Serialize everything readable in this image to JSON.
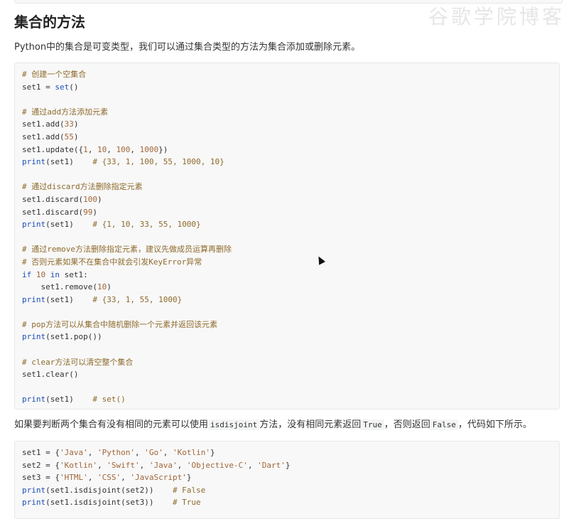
{
  "page": {
    "watermark": "谷歌学院博客",
    "heading": "集合的方法",
    "intro": "Python中的集合是可变类型，我们可以通过集合类型的方法为集合添加或删除元素。",
    "disjoint_text": {
      "before": "如果要判断两个集合有没有相同的元素可以使用",
      "method": "isdisjoint",
      "middle": "方法，没有相同元素返回",
      "true_val": "True",
      "mid2": "，否则返回",
      "false_val": "False",
      "after": "，代码如下所示。"
    }
  },
  "code_block_1": {
    "lines": [
      [
        {
          "t": "# 创建一个空集合",
          "c": "c"
        }
      ],
      [
        {
          "t": "set1 = "
        },
        {
          "t": "set",
          "c": "k"
        },
        {
          "t": "()"
        }
      ],
      [],
      [
        {
          "t": "# 通过add方法添加元素",
          "c": "c"
        }
      ],
      [
        {
          "t": "set1.add("
        },
        {
          "t": "33",
          "c": "n"
        },
        {
          "t": ")"
        }
      ],
      [
        {
          "t": "set1.add("
        },
        {
          "t": "55",
          "c": "n"
        },
        {
          "t": ")"
        }
      ],
      [
        {
          "t": "set1.update({"
        },
        {
          "t": "1",
          "c": "n"
        },
        {
          "t": ", "
        },
        {
          "t": "10",
          "c": "n"
        },
        {
          "t": ", "
        },
        {
          "t": "100",
          "c": "n"
        },
        {
          "t": ", "
        },
        {
          "t": "1000",
          "c": "n"
        },
        {
          "t": "})"
        }
      ],
      [
        {
          "t": "print",
          "c": "k"
        },
        {
          "t": "(set1)    "
        },
        {
          "t": "# {33, 1, 100, 55, 1000, 10}",
          "c": "c"
        }
      ],
      [],
      [
        {
          "t": "# 通过discard方法删除指定元素",
          "c": "c"
        }
      ],
      [
        {
          "t": "set1.discard("
        },
        {
          "t": "100",
          "c": "n"
        },
        {
          "t": ")"
        }
      ],
      [
        {
          "t": "set1.discard("
        },
        {
          "t": "99",
          "c": "n"
        },
        {
          "t": ")"
        }
      ],
      [
        {
          "t": "print",
          "c": "k"
        },
        {
          "t": "(set1)    "
        },
        {
          "t": "# {1, 10, 33, 55, 1000}",
          "c": "c"
        }
      ],
      [],
      [
        {
          "t": "# 通过remove方法删除指定元素，建议先做成员运算再删除",
          "c": "c"
        }
      ],
      [
        {
          "t": "# 否则元素如果不在集合中就会引发KeyError异常",
          "c": "c"
        }
      ],
      [
        {
          "t": "if",
          "c": "k"
        },
        {
          "t": " "
        },
        {
          "t": "10",
          "c": "n"
        },
        {
          "t": " "
        },
        {
          "t": "in",
          "c": "k"
        },
        {
          "t": " set1:"
        }
      ],
      [
        {
          "t": "    set1.remove("
        },
        {
          "t": "10",
          "c": "n"
        },
        {
          "t": ")"
        }
      ],
      [
        {
          "t": "print",
          "c": "k"
        },
        {
          "t": "(set1)    "
        },
        {
          "t": "# {33, 1, 55, 1000}",
          "c": "c"
        }
      ],
      [],
      [
        {
          "t": "# pop方法可以从集合中随机删除一个元素并返回该元素",
          "c": "c"
        }
      ],
      [
        {
          "t": "print",
          "c": "k"
        },
        {
          "t": "(set1.pop())"
        }
      ],
      [],
      [
        {
          "t": "# clear方法可以清空整个集合",
          "c": "c"
        }
      ],
      [
        {
          "t": "set1.clear()"
        }
      ],
      [],
      [
        {
          "t": "print",
          "c": "k"
        },
        {
          "t": "(set1)    "
        },
        {
          "t": "# set()",
          "c": "c"
        }
      ]
    ]
  },
  "code_block_2": {
    "lines": [
      [
        {
          "t": "set1 = {"
        },
        {
          "t": "'Java'",
          "c": "s"
        },
        {
          "t": ", "
        },
        {
          "t": "'Python'",
          "c": "s"
        },
        {
          "t": ", "
        },
        {
          "t": "'Go'",
          "c": "s"
        },
        {
          "t": ", "
        },
        {
          "t": "'Kotlin'",
          "c": "s"
        },
        {
          "t": "}"
        }
      ],
      [
        {
          "t": "set2 = {"
        },
        {
          "t": "'Kotlin'",
          "c": "s"
        },
        {
          "t": ", "
        },
        {
          "t": "'Swift'",
          "c": "s"
        },
        {
          "t": ", "
        },
        {
          "t": "'Java'",
          "c": "s"
        },
        {
          "t": ", "
        },
        {
          "t": "'Objective-C'",
          "c": "s"
        },
        {
          "t": ", "
        },
        {
          "t": "'Dart'",
          "c": "s"
        },
        {
          "t": "}"
        }
      ],
      [
        {
          "t": "set3 = {"
        },
        {
          "t": "'HTML'",
          "c": "s"
        },
        {
          "t": ", "
        },
        {
          "t": "'CSS'",
          "c": "s"
        },
        {
          "t": ", "
        },
        {
          "t": "'JavaScript'",
          "c": "s"
        },
        {
          "t": "}"
        }
      ],
      [
        {
          "t": "print",
          "c": "k"
        },
        {
          "t": "(set1.isdisjoint(set2))    "
        },
        {
          "t": "# False",
          "c": "c"
        }
      ],
      [
        {
          "t": "print",
          "c": "k"
        },
        {
          "t": "(set1.isdisjoint(set3))    "
        },
        {
          "t": "# True",
          "c": "c"
        }
      ]
    ]
  }
}
